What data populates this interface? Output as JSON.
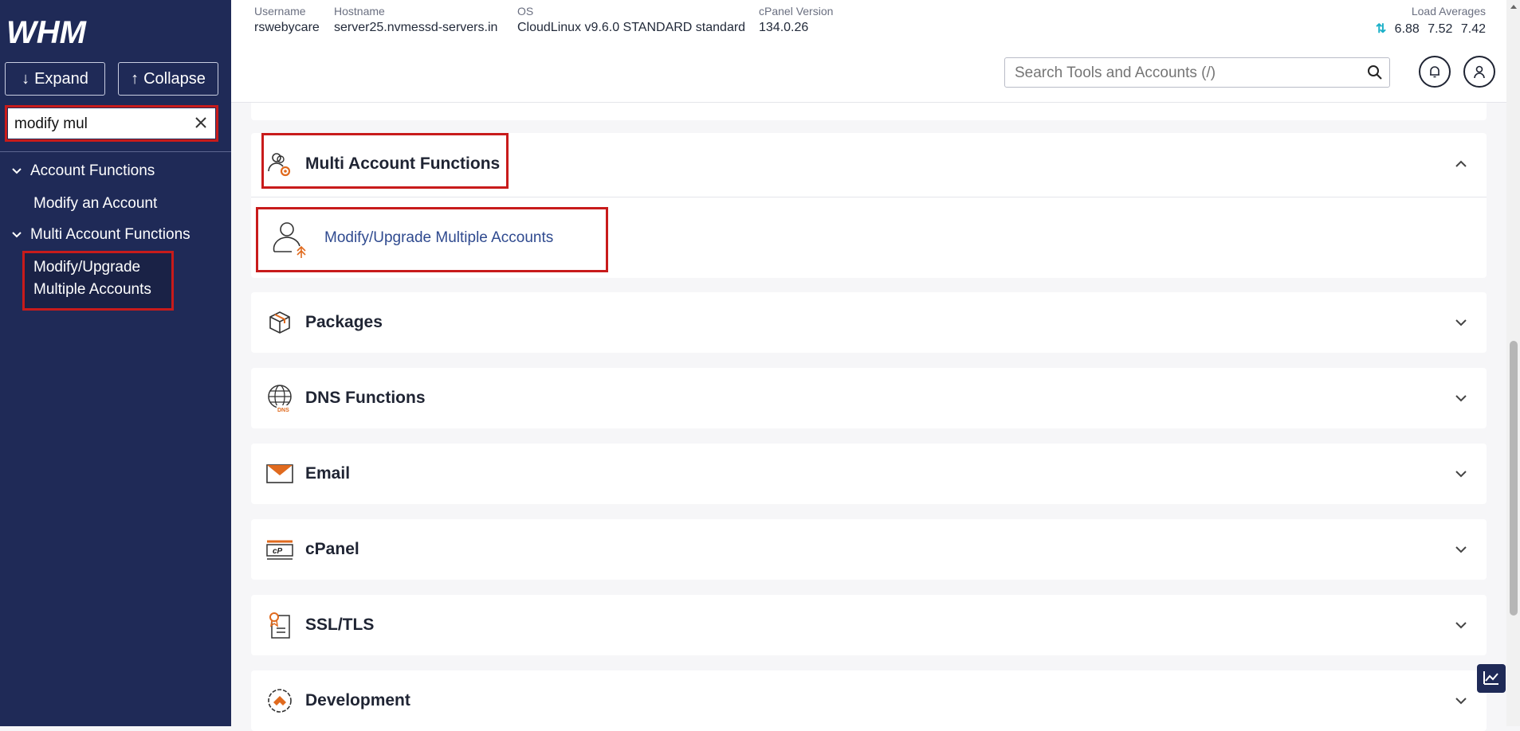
{
  "sidebar": {
    "logo_text": "WHM",
    "expand_label": "Expand",
    "collapse_label": "Collapse",
    "search_value": "modify mul",
    "categories": [
      {
        "label": "Account Functions",
        "items": [
          "Modify an Account"
        ]
      },
      {
        "label": "Multi Account Functions",
        "items": [
          "Modify/Upgrade",
          "Multiple Accounts"
        ]
      }
    ]
  },
  "server_info": {
    "username_label": "Username",
    "username": "rswebycare",
    "hostname_label": "Hostname",
    "hostname": "server25.nvmessd-servers.in",
    "os_label": "OS",
    "os": "CloudLinux v9.6.0 STANDARD standard",
    "cpanel_version_label": "cPanel Version",
    "cpanel_version": "134.0.26",
    "load_label": "Load Averages",
    "load_1": "6.88",
    "load_5": "7.52",
    "load_15": "7.42"
  },
  "search": {
    "placeholder": "Search Tools and Accounts (/)"
  },
  "sections": [
    {
      "title": "Multi Account Functions",
      "icon": "multi-account-icon",
      "expanded": true,
      "tools": [
        "Modify/Upgrade Multiple Accounts"
      ]
    },
    {
      "title": "Packages",
      "icon": "package-icon"
    },
    {
      "title": "DNS Functions",
      "icon": "dns-globe-icon"
    },
    {
      "title": "Email",
      "icon": "envelope-icon"
    },
    {
      "title": "cPanel",
      "icon": "cpanel-icon"
    },
    {
      "title": "SSL/TLS",
      "icon": "certificate-icon"
    },
    {
      "title": "Development",
      "icon": "development-icon"
    }
  ],
  "colors": {
    "sidebar_bg": "#1f2a57",
    "highlight": "#c81b1b",
    "link": "#2f4a8f",
    "load_arrows": "#1bb0c8"
  }
}
